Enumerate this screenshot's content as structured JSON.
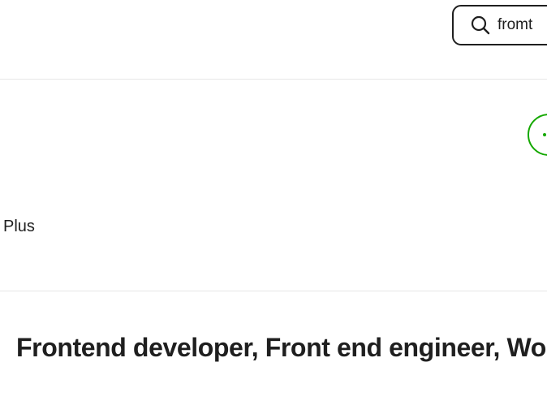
{
  "search": {
    "value": "fromt",
    "icon": "search-icon"
  },
  "plan": {
    "label": "l Plus"
  },
  "more_button": {
    "icon": "ellipsis-icon",
    "color": "#14a800"
  },
  "job": {
    "title": "Frontend developer, Front end engineer, Word"
  }
}
